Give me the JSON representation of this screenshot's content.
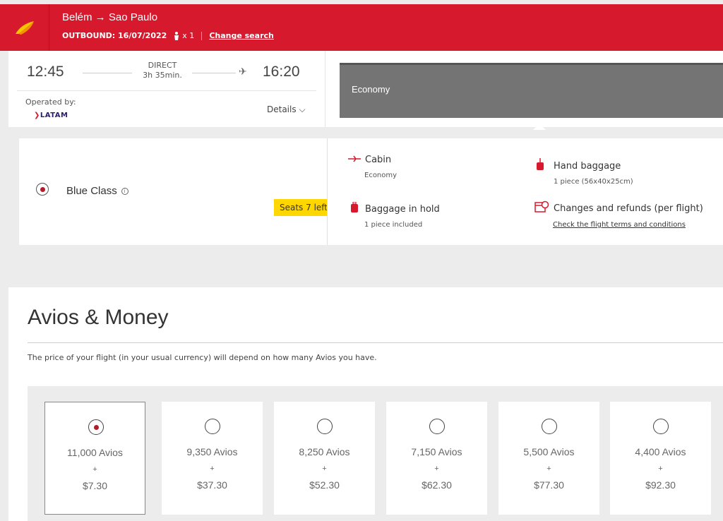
{
  "header": {
    "route": "Belém → Sao Paulo",
    "outbound": "OUTBOUND: 16/07/2022",
    "passengers": "x 1",
    "change_search": "Change search",
    "brand_color": "#d7192d"
  },
  "flight": {
    "departure": "12:45",
    "arrival": "16:20",
    "type": "DIRECT",
    "duration": "3h 35min.",
    "operated_by_label": "Operated by:",
    "operator": "LATAM",
    "details_label": "Details"
  },
  "cabin_tab": {
    "label": "Economy"
  },
  "fare": {
    "name": "Blue Class",
    "seats_left": "Seats 7 left",
    "cabin_title": "Cabin",
    "cabin_value": "Economy",
    "hand_baggage_title": "Hand baggage",
    "hand_baggage_value": "1 piece (56x40x25cm)",
    "hold_title": "Baggage in hold",
    "hold_value": "1 piece included",
    "changes_title": "Changes and refunds (per flight)",
    "terms_link": "Check the flight terms and conditions"
  },
  "avios": {
    "title": "Avios & Money",
    "description": "The price of your flight (in your usual currency) will depend on how many Avios you have.",
    "options": [
      {
        "avios": "11,000 Avios",
        "plus": "+",
        "money": "$7.30",
        "selected": true
      },
      {
        "avios": "9,350 Avios",
        "plus": "+",
        "money": "$37.30",
        "selected": false
      },
      {
        "avios": "8,250 Avios",
        "plus": "+",
        "money": "$52.30",
        "selected": false
      },
      {
        "avios": "7,150 Avios",
        "plus": "+",
        "money": "$62.30",
        "selected": false
      },
      {
        "avios": "5,500 Avios",
        "plus": "+",
        "money": "$77.30",
        "selected": false
      },
      {
        "avios": "4,400 Avios",
        "plus": "+",
        "money": "$92.30",
        "selected": false
      }
    ]
  }
}
